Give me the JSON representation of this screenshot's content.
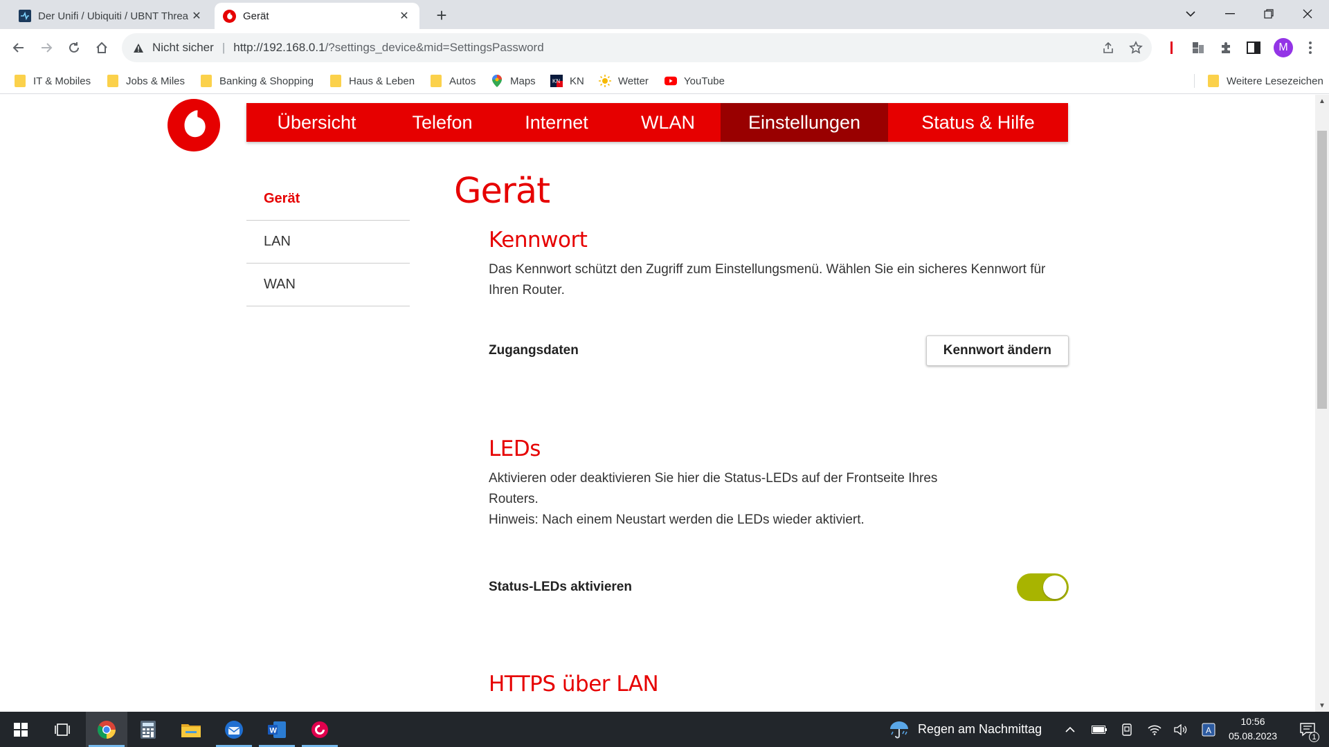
{
  "browser": {
    "tabs": [
      {
        "title": "Der Unifi / Ubiquiti / UBNT Threa",
        "favicon": "forum-icon"
      },
      {
        "title": "Gerät",
        "favicon": "vodafone-icon"
      }
    ],
    "address_bar": {
      "security_label": "Nicht sicher",
      "url_host": "http://192.168.0.1",
      "url_path": "/?settings_device&mid=SettingsPassword"
    },
    "bookmarks": [
      {
        "label": "IT & Mobiles"
      },
      {
        "label": "Jobs & Miles"
      },
      {
        "label": "Banking & Shopping"
      },
      {
        "label": "Haus & Leben"
      },
      {
        "label": "Autos"
      },
      {
        "label": "Maps"
      },
      {
        "label": "KN"
      },
      {
        "label": "Wetter"
      },
      {
        "label": "YouTube"
      }
    ],
    "other_bookmarks": "Weitere Lesezeichen",
    "profile_initial": "M"
  },
  "router": {
    "nav": [
      "Übersicht",
      "Telefon",
      "Internet",
      "WLAN",
      "Einstellungen",
      "Status & Hilfe"
    ],
    "active_nav": "Einstellungen",
    "sidebar": [
      {
        "label": "Gerät"
      },
      {
        "label": "LAN"
      },
      {
        "label": "WAN"
      }
    ],
    "page_title": "Gerät",
    "sections": {
      "password": {
        "title": "Kennwort",
        "description": "Das Kennwort schützt den Zugriff zum Einstellungsmenü. Wählen Sie ein sicheres Kennwort für Ihren Router.",
        "row_label": "Zugangsdaten",
        "button": "Kennwort ändern"
      },
      "leds": {
        "title": "LEDs",
        "description": "Aktivieren oder deaktivieren Sie hier die Status-LEDs auf der Frontseite Ihres Routers.",
        "hint": "Hinweis: Nach einem Neustart werden die LEDs wieder aktiviert.",
        "row_label": "Status-LEDs aktivieren",
        "toggle_on": true
      },
      "https": {
        "title": "HTTPS über LAN"
      }
    },
    "colors": {
      "brand_red": "#e60000",
      "active_nav": "#990000",
      "toggle_on": "#a8b400"
    }
  },
  "taskbar": {
    "weather": "Regen am Nachmittag",
    "time": "10:56",
    "date": "05.08.2023",
    "notifications": "1"
  }
}
